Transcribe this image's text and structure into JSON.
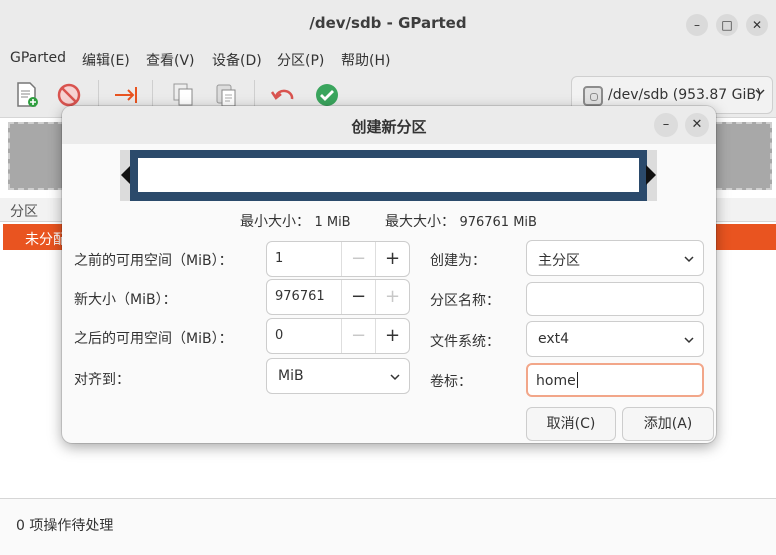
{
  "window": {
    "title": "/dev/sdb - GParted",
    "minimize": "–",
    "maximize": "□",
    "close": "✕"
  },
  "menu": [
    "GParted",
    "编辑(E)",
    "查看(V)",
    "设备(D)",
    "分区(P)",
    "帮助(H)"
  ],
  "toolbar": {
    "icons": [
      "new-partition-icon",
      "delete-icon",
      "resize-move-icon",
      "copy-icon",
      "paste-icon",
      "undo-icon",
      "apply-icon"
    ],
    "device": "/dev/sdb (953.87 GiB)"
  },
  "partition_list": {
    "header": "分区",
    "selected_row": "未分配"
  },
  "status": "0 项操作待处理",
  "dialog": {
    "title": "创建新分区",
    "min_size_label": "最小大小：",
    "min_size_value": "1 MiB",
    "max_size_label": "最大大小：",
    "max_size_value": "976761 MiB",
    "free_before_label": "之前的可用空间（MiB）：",
    "free_before_value": "1",
    "new_size_label": "新大小（MiB）：",
    "new_size_value": "976761",
    "free_after_label": "之后的可用空间（MiB）：",
    "free_after_value": "0",
    "align_label": "对齐到：",
    "align_value": "MiB",
    "create_as_label": "创建为：",
    "create_as_value": "主分区",
    "part_name_label": "分区名称：",
    "part_name_value": "",
    "fs_label": "文件系统：",
    "fs_value": "ext4",
    "volume_label": "卷标：",
    "volume_value": "home",
    "cancel": "取消(C)",
    "add": "添加(A)",
    "minus": "−",
    "plus": "+",
    "dialog_minimize": "–",
    "dialog_close": "✕"
  }
}
